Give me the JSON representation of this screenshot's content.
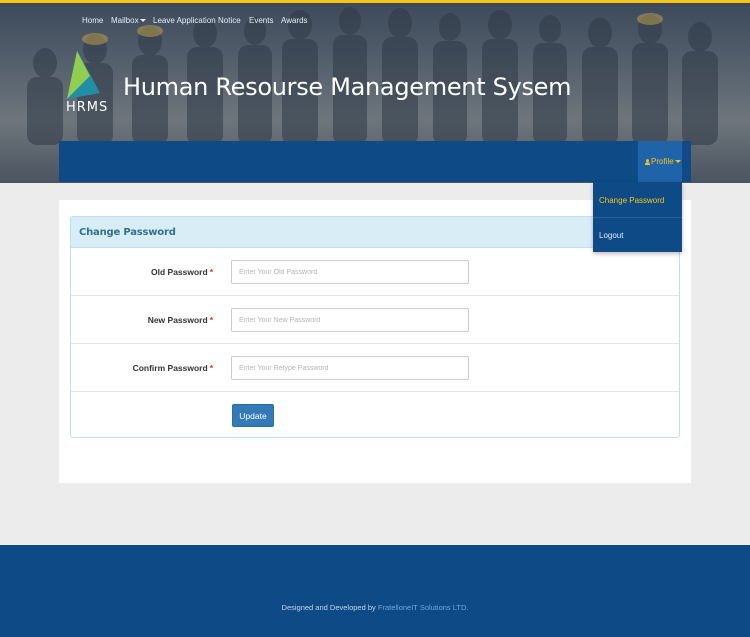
{
  "header": {
    "logo_text": "HRMS",
    "app_title": "Human Resourse Management Sysem"
  },
  "nav": {
    "home": "Home",
    "mailbox": "Mailbox",
    "leave_application": "Leave Application",
    "notice": "Notice",
    "events": "Events",
    "awards": "Awards",
    "profile": "Profile"
  },
  "profile_menu": {
    "change_password": "Change Password",
    "logout": "Logout"
  },
  "panel": {
    "title": "Change Password"
  },
  "form": {
    "old_password": {
      "label": "Old Password",
      "required_mark": "*",
      "value": "",
      "placeholder": "Enter Your Old Password"
    },
    "new_password": {
      "label": "New Password",
      "required_mark": "*",
      "value": "",
      "placeholder": "Enter Your New Password"
    },
    "confirm_password": {
      "label": "Confirm Password",
      "required_mark": "*",
      "value": "",
      "placeholder": "Enter Your Retype Password"
    },
    "submit_label": "Update"
  },
  "footer": {
    "prefix": "Designed and Developed by",
    "company": "FratelloneIT Solutions LTD."
  },
  "icons": {
    "logo": "hrms-triangle-logo-icon",
    "user": "user-icon",
    "caret": "caret-down-icon"
  },
  "colors": {
    "navbar": "#0d4a86",
    "accent": "#f5c518",
    "panel_heading": "#d9edf7",
    "button_primary": "#337ab7",
    "required": "#d9302c"
  }
}
